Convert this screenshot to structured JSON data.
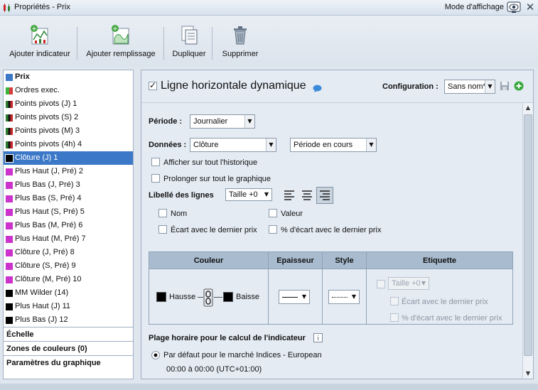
{
  "window": {
    "title": "Propriétés - Prix",
    "mode_label": "Mode d'affichage"
  },
  "toolbar": {
    "add_indicator": "Ajouter indicateur",
    "add_fill": "Ajouter remplissage",
    "duplicate": "Dupliquer",
    "delete": "Supprimer"
  },
  "sidebar": {
    "items": [
      {
        "label": "Prix",
        "color": "#3b78c8",
        "bold": true
      },
      {
        "label": "Ordres exec.",
        "color": "#3cb43c"
      },
      {
        "label": "Points pivots (J) 1",
        "color": "#111111"
      },
      {
        "label": "Points pivots (S) 2",
        "color": "#111111"
      },
      {
        "label": "Points pivots (M) 3",
        "color": "#111111"
      },
      {
        "label": "Points pivots (4h) 4",
        "color": "#111111"
      },
      {
        "label": "Clôture (J) 1",
        "color": "#000000",
        "selected": true
      },
      {
        "label": "Plus Haut (J, Pré) 2",
        "color": "#cc33cc"
      },
      {
        "label": "Plus Bas (J, Pré) 3",
        "color": "#cc33cc"
      },
      {
        "label": "Plus Bas (S, Pré) 4",
        "color": "#cc33cc"
      },
      {
        "label": "Plus Haut (S, Pré) 5",
        "color": "#cc33cc"
      },
      {
        "label": "Plus Bas (M, Pré) 6",
        "color": "#cc33cc"
      },
      {
        "label": "Plus Haut (M, Pré) 7",
        "color": "#cc33cc"
      },
      {
        "label": "Clôture (J, Pré) 8",
        "color": "#cc33cc"
      },
      {
        "label": "Clôture (S, Pré) 9",
        "color": "#cc33cc"
      },
      {
        "label": "Clôture (M, Pré) 10",
        "color": "#cc33cc"
      },
      {
        "label": "MM Wilder (14)",
        "color": "#000000"
      },
      {
        "label": "Plus Haut (J) 11",
        "color": "#000000"
      },
      {
        "label": "Plus Bas (J) 12",
        "color": "#000000"
      }
    ],
    "sections": [
      "Échelle",
      "Zones de couleurs (0)",
      "Paramètres du graphique"
    ]
  },
  "panel": {
    "title": "Ligne horizontale dynamique",
    "config_label": "Configuration :",
    "config_value": "Sans nom*",
    "period_label": "Période :",
    "period_value": "Journalier",
    "data_label": "Données :",
    "data_value": "Clôture",
    "data_period_value": "Période en cours",
    "show_history": "Afficher sur tout l'historique",
    "extend_chart": "Prolonger sur tout le graphique",
    "line_labels": "Libellé des lignes",
    "size_value": "Taille +0",
    "opt_name": "Nom",
    "opt_value": "Valeur",
    "opt_gap": "Écart avec le dernier prix",
    "opt_gap_pct": "% d'écart avec le dernier prix",
    "table": {
      "headers": [
        "Couleur",
        "Epaisseur",
        "Style",
        "Etiquette"
      ],
      "up_label": "Hausse",
      "down_label": "Baisse",
      "up_color": "#000000",
      "down_color": "#000000",
      "tag_size": "Taille +0",
      "tag_gap": "Écart avec le dernier prix",
      "tag_gap_pct": "% d'écart avec le dernier prix"
    },
    "time_range_label": "Plage horaire pour le calcul de l'indicateur",
    "default_market": "Par défaut pour le marché Indices - European",
    "time_range": "00:00 à 00:00 (UTC+01:00)"
  }
}
